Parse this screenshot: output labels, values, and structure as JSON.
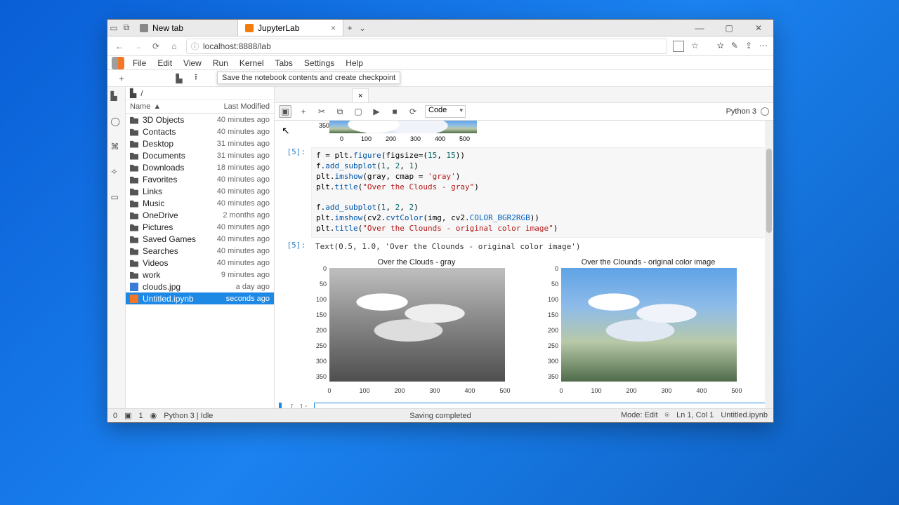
{
  "browser": {
    "tabs": [
      {
        "title": "New tab"
      },
      {
        "title": "JupyterLab"
      }
    ],
    "url": "localhost:8888/lab"
  },
  "tooltip": "Save the notebook contents and create checkpoint",
  "jupyter": {
    "menu": [
      "File",
      "Edit",
      "View",
      "Run",
      "Kernel",
      "Tabs",
      "Settings",
      "Help"
    ],
    "breadcrumb_icon": "folder-icon",
    "breadcrumb": "/",
    "file_header_name": "Name",
    "file_header_modified": "Last Modified",
    "files": [
      {
        "icon": "folder",
        "name": "3D Objects",
        "mod": "40 minutes ago"
      },
      {
        "icon": "folder",
        "name": "Contacts",
        "mod": "40 minutes ago"
      },
      {
        "icon": "folder",
        "name": "Desktop",
        "mod": "31 minutes ago"
      },
      {
        "icon": "folder",
        "name": "Documents",
        "mod": "31 minutes ago"
      },
      {
        "icon": "folder",
        "name": "Downloads",
        "mod": "18 minutes ago"
      },
      {
        "icon": "folder",
        "name": "Favorites",
        "mod": "40 minutes ago"
      },
      {
        "icon": "folder",
        "name": "Links",
        "mod": "40 minutes ago"
      },
      {
        "icon": "folder",
        "name": "Music",
        "mod": "40 minutes ago"
      },
      {
        "icon": "folder",
        "name": "OneDrive",
        "mod": "2 months ago"
      },
      {
        "icon": "folder",
        "name": "Pictures",
        "mod": "40 minutes ago"
      },
      {
        "icon": "folder",
        "name": "Saved Games",
        "mod": "40 minutes ago"
      },
      {
        "icon": "folder",
        "name": "Searches",
        "mod": "40 minutes ago"
      },
      {
        "icon": "folder",
        "name": "Videos",
        "mod": "40 minutes ago"
      },
      {
        "icon": "folder",
        "name": "work",
        "mod": "9 minutes ago"
      },
      {
        "icon": "img",
        "name": "clouds.jpg",
        "mod": "a day ago"
      },
      {
        "icon": "nb",
        "name": "Untitled.ipynb",
        "mod": "seconds ago",
        "selected": true
      }
    ],
    "notebook_tab_close": "×",
    "toolbar_cell_type": "Code",
    "kernel_name": "Python 3",
    "cells": {
      "c5_prompt": "[5]:",
      "c5_code": "f = plt.figure(figsize=(15, 15))\nf.add_subplot(1, 2, 1)\nplt.imshow(gray, cmap = 'gray')\nplt.title(\"Over the Clouds - gray\")\n\nf.add_subplot(1, 2, 2)\nplt.imshow(cv2.cvtColor(img, cv2.COLOR_BGR2RGB))\nplt.title(\"Over the Clounds - original color image\")",
      "c5_out_prompt": "[5]:",
      "c5_out": "Text(0.5, 1.0, 'Over the Clounds - original color image')",
      "fig1_title": "Over the Clouds - gray",
      "fig2_title": "Over the Clounds - original color image",
      "empty_prompt": "[ ]:"
    }
  },
  "chart_data": [
    {
      "type": "image-plot",
      "note": "partial top output of earlier imshow",
      "y_ticks_visible": [
        350
      ],
      "x_ticks": [
        0,
        100,
        200,
        300,
        400,
        500
      ]
    },
    {
      "type": "image-plot",
      "title": "Over the Clouds - gray",
      "y_ticks": [
        0,
        50,
        100,
        150,
        200,
        250,
        300,
        350
      ],
      "x_ticks": [
        0,
        100,
        200,
        300,
        400,
        500
      ],
      "colormap": "gray"
    },
    {
      "type": "image-plot",
      "title": "Over the Clounds - original color image",
      "y_ticks": [
        0,
        50,
        100,
        150,
        200,
        250,
        300,
        350
      ],
      "x_ticks": [
        0,
        100,
        200,
        300,
        400,
        500
      ],
      "colormap": "rgb"
    }
  ],
  "status": {
    "left_0": "0",
    "left_terms": "1",
    "left_kernel": "Python 3 | Idle",
    "center": "Saving completed",
    "right_mode": "Mode: Edit",
    "right_ln": "Ln 1, Col 1",
    "right_file": "Untitled.ipynb"
  }
}
